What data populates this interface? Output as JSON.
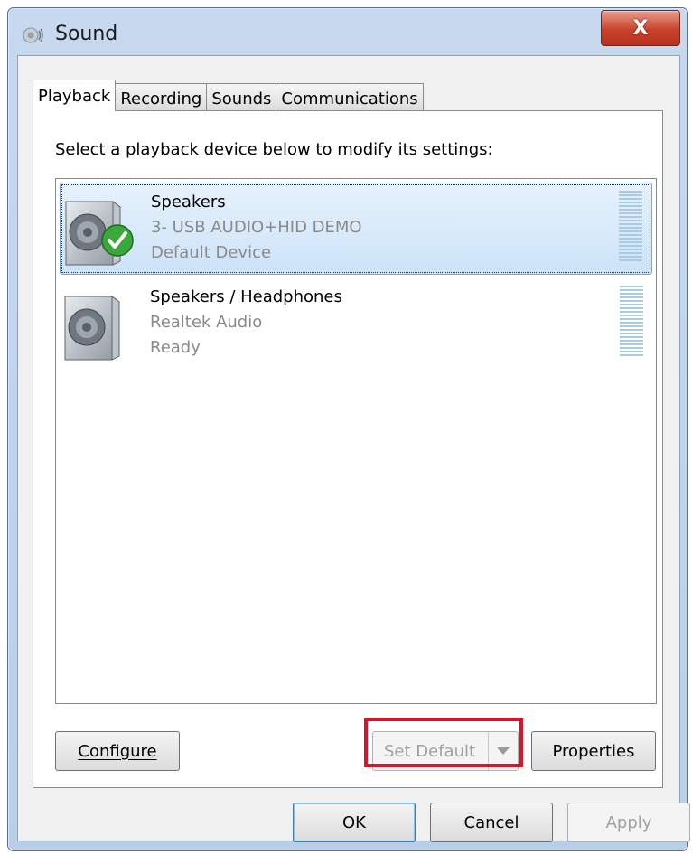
{
  "window": {
    "title": "Sound",
    "close_label": "X"
  },
  "tabs": [
    {
      "label": "Playback",
      "active": true
    },
    {
      "label": "Recording",
      "active": false
    },
    {
      "label": "Sounds",
      "active": false
    },
    {
      "label": "Communications",
      "active": false
    }
  ],
  "instruction": "Select a playback device below to modify its settings:",
  "devices": [
    {
      "name": "Speakers",
      "description": "3- USB AUDIO+HID DEMO",
      "status": "Default Device",
      "icon": "speaker-icon",
      "default_badge": "green-check-icon",
      "selected": true
    },
    {
      "name": "Speakers / Headphones",
      "description": "Realtek Audio",
      "status": "Ready",
      "icon": "speaker-icon",
      "selected": false
    }
  ],
  "buttons": {
    "configure": "Configure",
    "set_default": "Set Default",
    "properties": "Properties",
    "ok": "OK",
    "cancel": "Cancel",
    "apply": "Apply"
  },
  "colors": {
    "highlight_box": "#d9142b",
    "selection": "#cde3f8",
    "close_button": "#c9412a"
  }
}
